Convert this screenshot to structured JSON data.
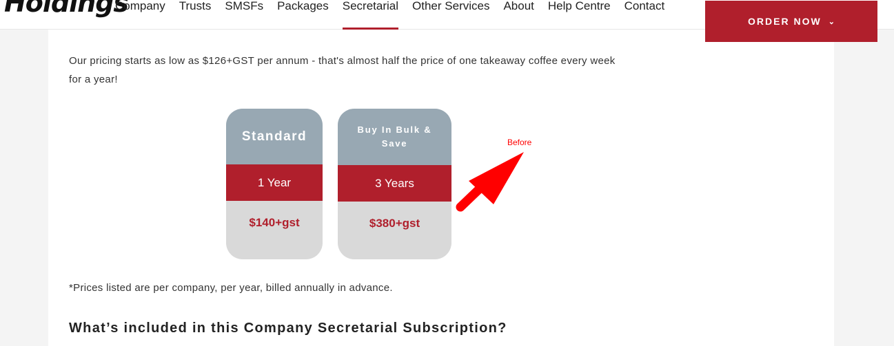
{
  "header": {
    "logo_text": "Holdings",
    "nav": [
      {
        "label": "Company"
      },
      {
        "label": "Trusts"
      },
      {
        "label": "SMSFs"
      },
      {
        "label": "Packages"
      },
      {
        "label": "Secretarial",
        "active": true
      },
      {
        "label": "Other Services"
      },
      {
        "label": "About"
      },
      {
        "label": "Help Centre"
      },
      {
        "label": "Contact"
      }
    ],
    "order_button": {
      "label": "ORDER NOW",
      "icon": "chevron-down-icon"
    }
  },
  "main": {
    "intro": "Our pricing starts as low as $126+GST per annum - that's almost half the price of one takeaway coffee every week for a year!",
    "plans": [
      {
        "title": "Standard",
        "term": "1 Year",
        "price": "$140+gst"
      },
      {
        "title": "Buy In Bulk & Save",
        "term": "3 Years",
        "price": "$380+gst"
      }
    ],
    "annotation": {
      "label": "Before",
      "color": "#ff0000",
      "icon": "arrow-icon"
    },
    "footnote": "*Prices listed are per company, per year, billed annually in advance.",
    "section_title": "What’s included in this Company Secretarial Subscription?"
  },
  "colors": {
    "brand_red": "#b01f2c",
    "plan_header": "#98a8b3",
    "plan_body": "#d9d9d9"
  }
}
